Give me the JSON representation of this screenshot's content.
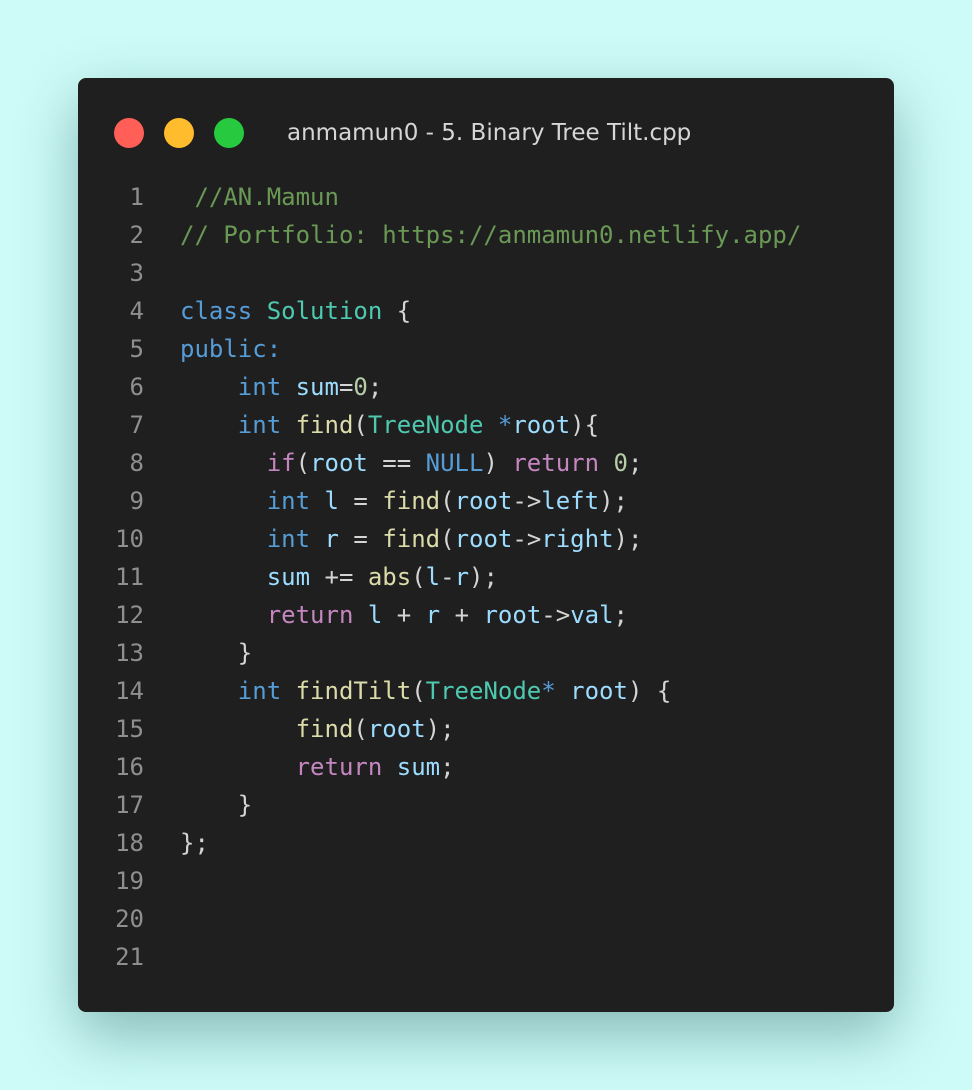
{
  "window": {
    "title": "anmamun0 - 5. Binary Tree Tilt.cpp",
    "controls": [
      {
        "name": "close",
        "color": "#ff5f56"
      },
      {
        "name": "minimize",
        "color": "#ffbd2e"
      },
      {
        "name": "zoom",
        "color": "#27c93f"
      }
    ]
  },
  "colors": {
    "background": "#cdfbf8",
    "editor": "#1f1f1f",
    "comment": "#6a9955",
    "keyword": "#569cd6",
    "control": "#c586c0",
    "type": "#4ec9b0",
    "variable": "#9cdcfe",
    "function": "#dcdcaa",
    "number": "#b5cea8",
    "punctuation": "#d4d4d4"
  },
  "code": {
    "language": "cpp",
    "lines": [
      {
        "n": "1",
        "tokens": [
          {
            "t": " //AN.Mamun",
            "k": "com"
          }
        ]
      },
      {
        "n": "2",
        "tokens": [
          {
            "t": "// Portfolio: https://anmamun0.netlify.app/",
            "k": "com"
          }
        ]
      },
      {
        "n": "3",
        "tokens": []
      },
      {
        "n": "4",
        "tokens": [
          {
            "t": "class",
            "k": "kw"
          },
          {
            "t": " ",
            "k": "pun"
          },
          {
            "t": "Solution",
            "k": "type"
          },
          {
            "t": " {",
            "k": "pun"
          }
        ]
      },
      {
        "n": "5",
        "tokens": [
          {
            "t": "public:",
            "k": "kw"
          }
        ]
      },
      {
        "n": "6",
        "tokens": [
          {
            "t": "    ",
            "k": "pun"
          },
          {
            "t": "int",
            "k": "kw"
          },
          {
            "t": " ",
            "k": "pun"
          },
          {
            "t": "sum",
            "k": "var"
          },
          {
            "t": "=",
            "k": "pun"
          },
          {
            "t": "0",
            "k": "num"
          },
          {
            "t": ";",
            "k": "pun"
          }
        ]
      },
      {
        "n": "7",
        "tokens": [
          {
            "t": "    ",
            "k": "pun"
          },
          {
            "t": "int",
            "k": "kw"
          },
          {
            "t": " ",
            "k": "pun"
          },
          {
            "t": "find",
            "k": "fn"
          },
          {
            "t": "(",
            "k": "pun"
          },
          {
            "t": "TreeNode",
            "k": "type"
          },
          {
            "t": " ",
            "k": "pun"
          },
          {
            "t": "*",
            "k": "kw"
          },
          {
            "t": "root",
            "k": "var"
          },
          {
            "t": "){",
            "k": "pun"
          }
        ]
      },
      {
        "n": "8",
        "tokens": [
          {
            "t": "      ",
            "k": "pun"
          },
          {
            "t": "if",
            "k": "ctl"
          },
          {
            "t": "(",
            "k": "pun"
          },
          {
            "t": "root",
            "k": "var"
          },
          {
            "t": " == ",
            "k": "pun"
          },
          {
            "t": "NULL",
            "k": "kw"
          },
          {
            "t": ") ",
            "k": "pun"
          },
          {
            "t": "return",
            "k": "ctl"
          },
          {
            "t": " ",
            "k": "pun"
          },
          {
            "t": "0",
            "k": "num"
          },
          {
            "t": ";",
            "k": "pun"
          }
        ]
      },
      {
        "n": "9",
        "tokens": [
          {
            "t": "      ",
            "k": "pun"
          },
          {
            "t": "int",
            "k": "kw"
          },
          {
            "t": " ",
            "k": "pun"
          },
          {
            "t": "l",
            "k": "var"
          },
          {
            "t": " = ",
            "k": "pun"
          },
          {
            "t": "find",
            "k": "fn"
          },
          {
            "t": "(",
            "k": "pun"
          },
          {
            "t": "root",
            "k": "var"
          },
          {
            "t": "->",
            "k": "pun"
          },
          {
            "t": "left",
            "k": "var"
          },
          {
            "t": ");",
            "k": "pun"
          }
        ]
      },
      {
        "n": "10",
        "tokens": [
          {
            "t": "      ",
            "k": "pun"
          },
          {
            "t": "int",
            "k": "kw"
          },
          {
            "t": " ",
            "k": "pun"
          },
          {
            "t": "r",
            "k": "var"
          },
          {
            "t": " = ",
            "k": "pun"
          },
          {
            "t": "find",
            "k": "fn"
          },
          {
            "t": "(",
            "k": "pun"
          },
          {
            "t": "root",
            "k": "var"
          },
          {
            "t": "->",
            "k": "pun"
          },
          {
            "t": "right",
            "k": "var"
          },
          {
            "t": ");",
            "k": "pun"
          }
        ]
      },
      {
        "n": "11",
        "tokens": [
          {
            "t": "      ",
            "k": "pun"
          },
          {
            "t": "sum",
            "k": "var"
          },
          {
            "t": " += ",
            "k": "pun"
          },
          {
            "t": "abs",
            "k": "fn"
          },
          {
            "t": "(",
            "k": "pun"
          },
          {
            "t": "l",
            "k": "var"
          },
          {
            "t": "-",
            "k": "pun"
          },
          {
            "t": "r",
            "k": "var"
          },
          {
            "t": ");",
            "k": "pun"
          }
        ]
      },
      {
        "n": "12",
        "tokens": [
          {
            "t": "      ",
            "k": "pun"
          },
          {
            "t": "return",
            "k": "ctl"
          },
          {
            "t": " ",
            "k": "pun"
          },
          {
            "t": "l",
            "k": "var"
          },
          {
            "t": " + ",
            "k": "pun"
          },
          {
            "t": "r",
            "k": "var"
          },
          {
            "t": " + ",
            "k": "pun"
          },
          {
            "t": "root",
            "k": "var"
          },
          {
            "t": "->",
            "k": "pun"
          },
          {
            "t": "val",
            "k": "var"
          },
          {
            "t": ";",
            "k": "pun"
          }
        ]
      },
      {
        "n": "13",
        "tokens": [
          {
            "t": "    }",
            "k": "pun"
          }
        ]
      },
      {
        "n": "14",
        "tokens": [
          {
            "t": "    ",
            "k": "pun"
          },
          {
            "t": "int",
            "k": "kw"
          },
          {
            "t": " ",
            "k": "pun"
          },
          {
            "t": "findTilt",
            "k": "fn"
          },
          {
            "t": "(",
            "k": "pun"
          },
          {
            "t": "TreeNode",
            "k": "type"
          },
          {
            "t": "*",
            "k": "kw"
          },
          {
            "t": " ",
            "k": "pun"
          },
          {
            "t": "root",
            "k": "var"
          },
          {
            "t": ") {",
            "k": "pun"
          }
        ]
      },
      {
        "n": "15",
        "tokens": [
          {
            "t": "        ",
            "k": "pun"
          },
          {
            "t": "find",
            "k": "fn"
          },
          {
            "t": "(",
            "k": "pun"
          },
          {
            "t": "root",
            "k": "var"
          },
          {
            "t": ");",
            "k": "pun"
          }
        ]
      },
      {
        "n": "16",
        "tokens": [
          {
            "t": "        ",
            "k": "pun"
          },
          {
            "t": "return",
            "k": "ctl"
          },
          {
            "t": " ",
            "k": "pun"
          },
          {
            "t": "sum",
            "k": "var"
          },
          {
            "t": ";",
            "k": "pun"
          }
        ]
      },
      {
        "n": "17",
        "tokens": [
          {
            "t": "    }",
            "k": "pun"
          }
        ]
      },
      {
        "n": "18",
        "tokens": [
          {
            "t": "};",
            "k": "pun"
          }
        ]
      },
      {
        "n": "19",
        "tokens": []
      },
      {
        "n": "20",
        "tokens": []
      },
      {
        "n": "21",
        "tokens": []
      }
    ]
  }
}
